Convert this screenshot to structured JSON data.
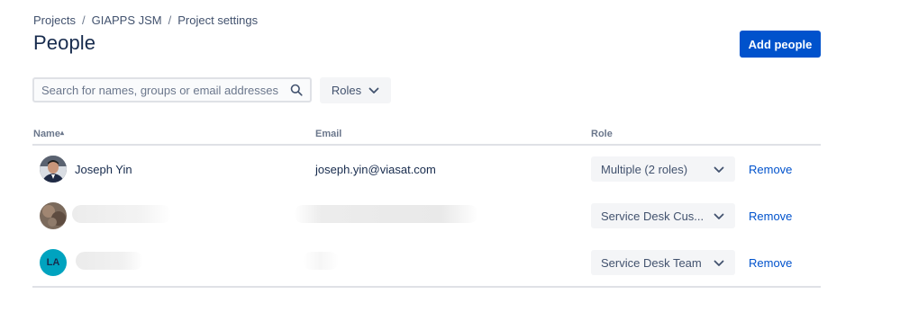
{
  "breadcrumbs": [
    "Projects",
    "GIAPPS JSM",
    "Project settings"
  ],
  "breadcrumb_separator": "/",
  "page_title": "People",
  "add_people_label": "Add people",
  "search": {
    "placeholder": "Search for names, groups or email addresses",
    "value": ""
  },
  "roles_filter_label": "Roles",
  "table": {
    "headers": {
      "name": "Name",
      "sort_indicator": "▴",
      "email": "Email",
      "role": "Role"
    },
    "rows": [
      {
        "name": "Joseph Yin",
        "email": "joseph.yin@viasat.com",
        "role": "Multiple (2 roles)",
        "action": "Remove",
        "avatar": "photo"
      },
      {
        "name": "",
        "email": "",
        "role": "Service Desk Cus...",
        "action": "Remove",
        "avatar": "photo"
      },
      {
        "name": "",
        "email": "",
        "role": "Service Desk Team",
        "action": "Remove",
        "avatar": "initials",
        "initials": "LA"
      }
    ]
  },
  "colors": {
    "primary": "#0052CC",
    "text": "#172B4D",
    "subtle": "#6B778C",
    "avatar_teal": "#00A3BF"
  }
}
